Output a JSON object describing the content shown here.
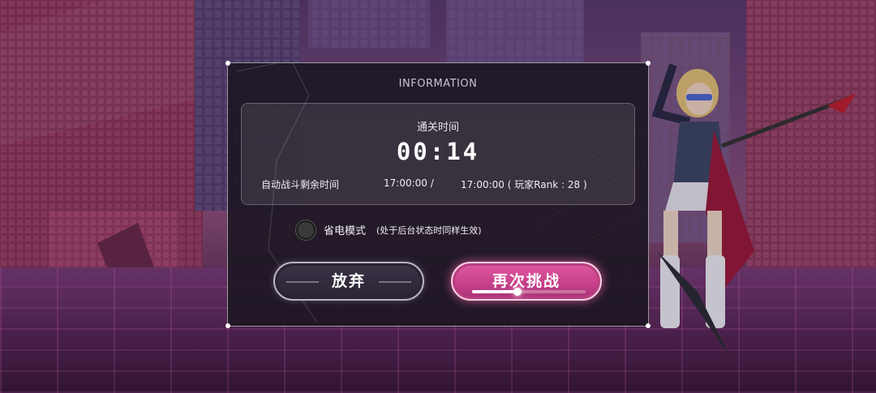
{
  "dialog": {
    "title": "INFORMATION",
    "clear_time_label": "通关时间",
    "clear_time_value": "00:14",
    "auto_battle_label": "自动战斗剩余时间",
    "auto_battle_value1": "17:00:00 /",
    "auto_battle_value2": "17:00:00 ( 玩家Rank : 28 )",
    "power_save_label": "省电模式",
    "power_save_note": "(处于后台状态时同样生效)",
    "power_save_checked": false,
    "give_up_label": "放弃",
    "retry_label": "再次挑战",
    "retry_progress": 0.4
  },
  "colors": {
    "retry_button": "#d14a93",
    "dialog_bg": "#1c1622",
    "scene_accent": "#8e4f7a"
  },
  "icons": {
    "power_save_radio": "radio-unchecked-icon"
  }
}
